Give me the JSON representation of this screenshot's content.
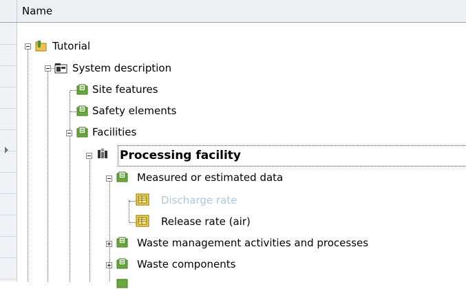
{
  "header": {
    "name_label": "Name"
  },
  "tree": {
    "tutorial": "Tutorial",
    "system_description": "System description",
    "site_features": "Site features",
    "safety_elements": "Safety elements",
    "facilities": "Facilities",
    "processing_facility": "Processing facility",
    "measured_data": "Measured or estimated data",
    "discharge_rate": "Discharge rate",
    "release_rate_air": "Release rate (air)",
    "waste_management": "Waste management activities and processes",
    "waste_components": "Waste components"
  },
  "colors": {
    "header_bg": "#eef0f3",
    "disabled_text": "#a9c9e6",
    "folder_green": "#6aaa3a"
  }
}
